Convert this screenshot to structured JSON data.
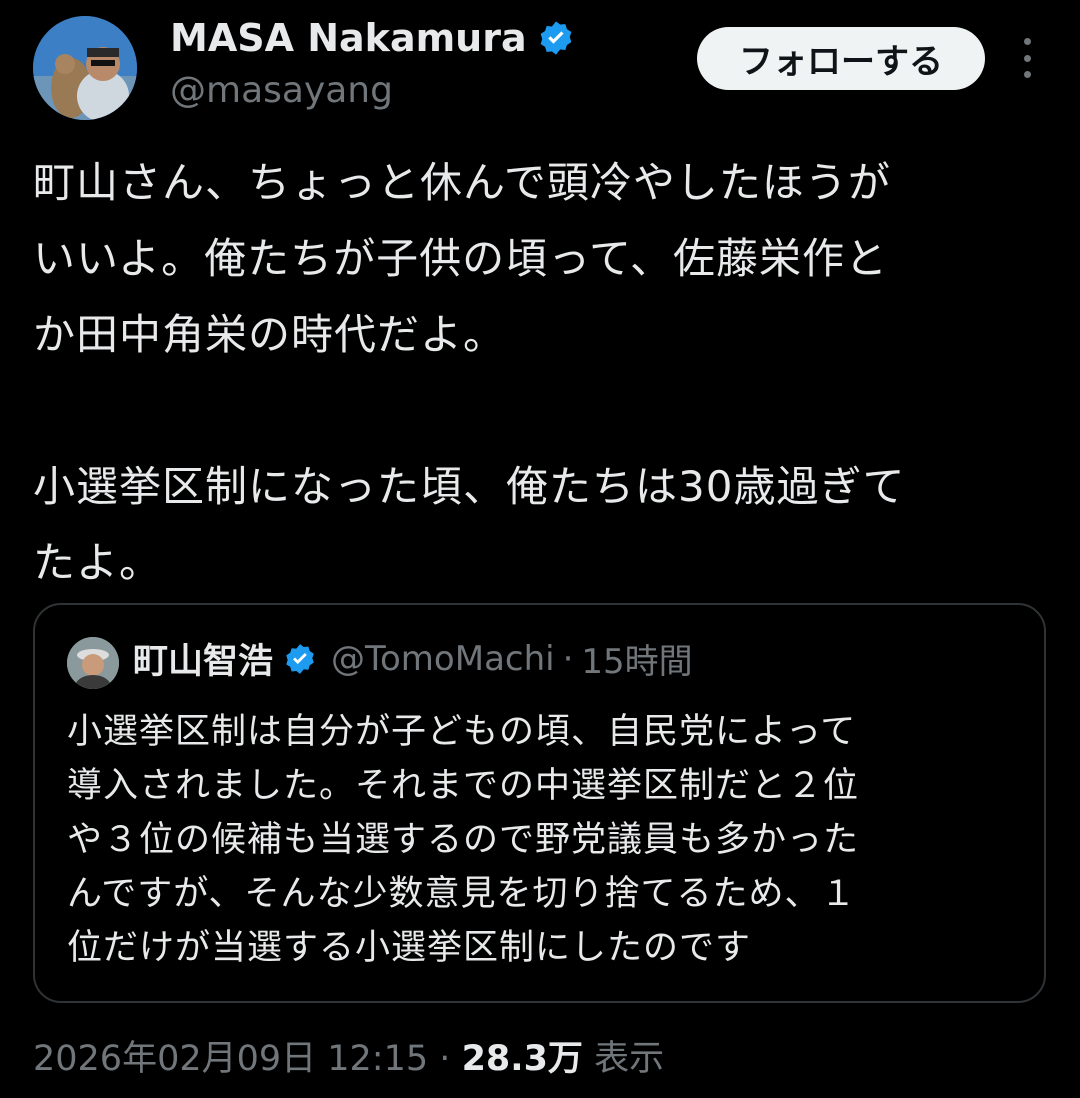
{
  "author": {
    "name": "MASA Nakamura",
    "handle": "@masayang",
    "verified": true
  },
  "follow_label": "フォローする",
  "tweet_text": "町山さん、ちょっと休んで頭冷やしたほうが\nいいよ。俺たちが子供の頃って、佐藤栄作と\nか田中角栄の時代だよ。\n\n小選挙区制になった頃、俺たちは30歳過ぎて\nたよ。",
  "quoted": {
    "name": "町山智浩",
    "handle": "@TomoMachi",
    "separator": "·",
    "time": "15時間",
    "text": "小選挙区制は自分が子どもの頃、自民党によって\n導入されました。それまでの中選挙区制だと２位\nや３位の候補も当選するので野党議員も多かった\nんですが、そんな少数意見を切り捨てるため、１\n位だけが当選する小選挙区制にしたのです"
  },
  "meta": {
    "timestamp": "2026年02月09日 12:15",
    "separator": "·",
    "views_count": "28.3万",
    "views_label": "表示"
  },
  "colors": {
    "background": "#000000",
    "text": "#e7e9ea",
    "muted": "#71767b",
    "verified": "#1d9bf0",
    "border": "#2f3336"
  },
  "icons": {
    "verified": "verified-badge-icon",
    "more": "more-options-icon"
  }
}
